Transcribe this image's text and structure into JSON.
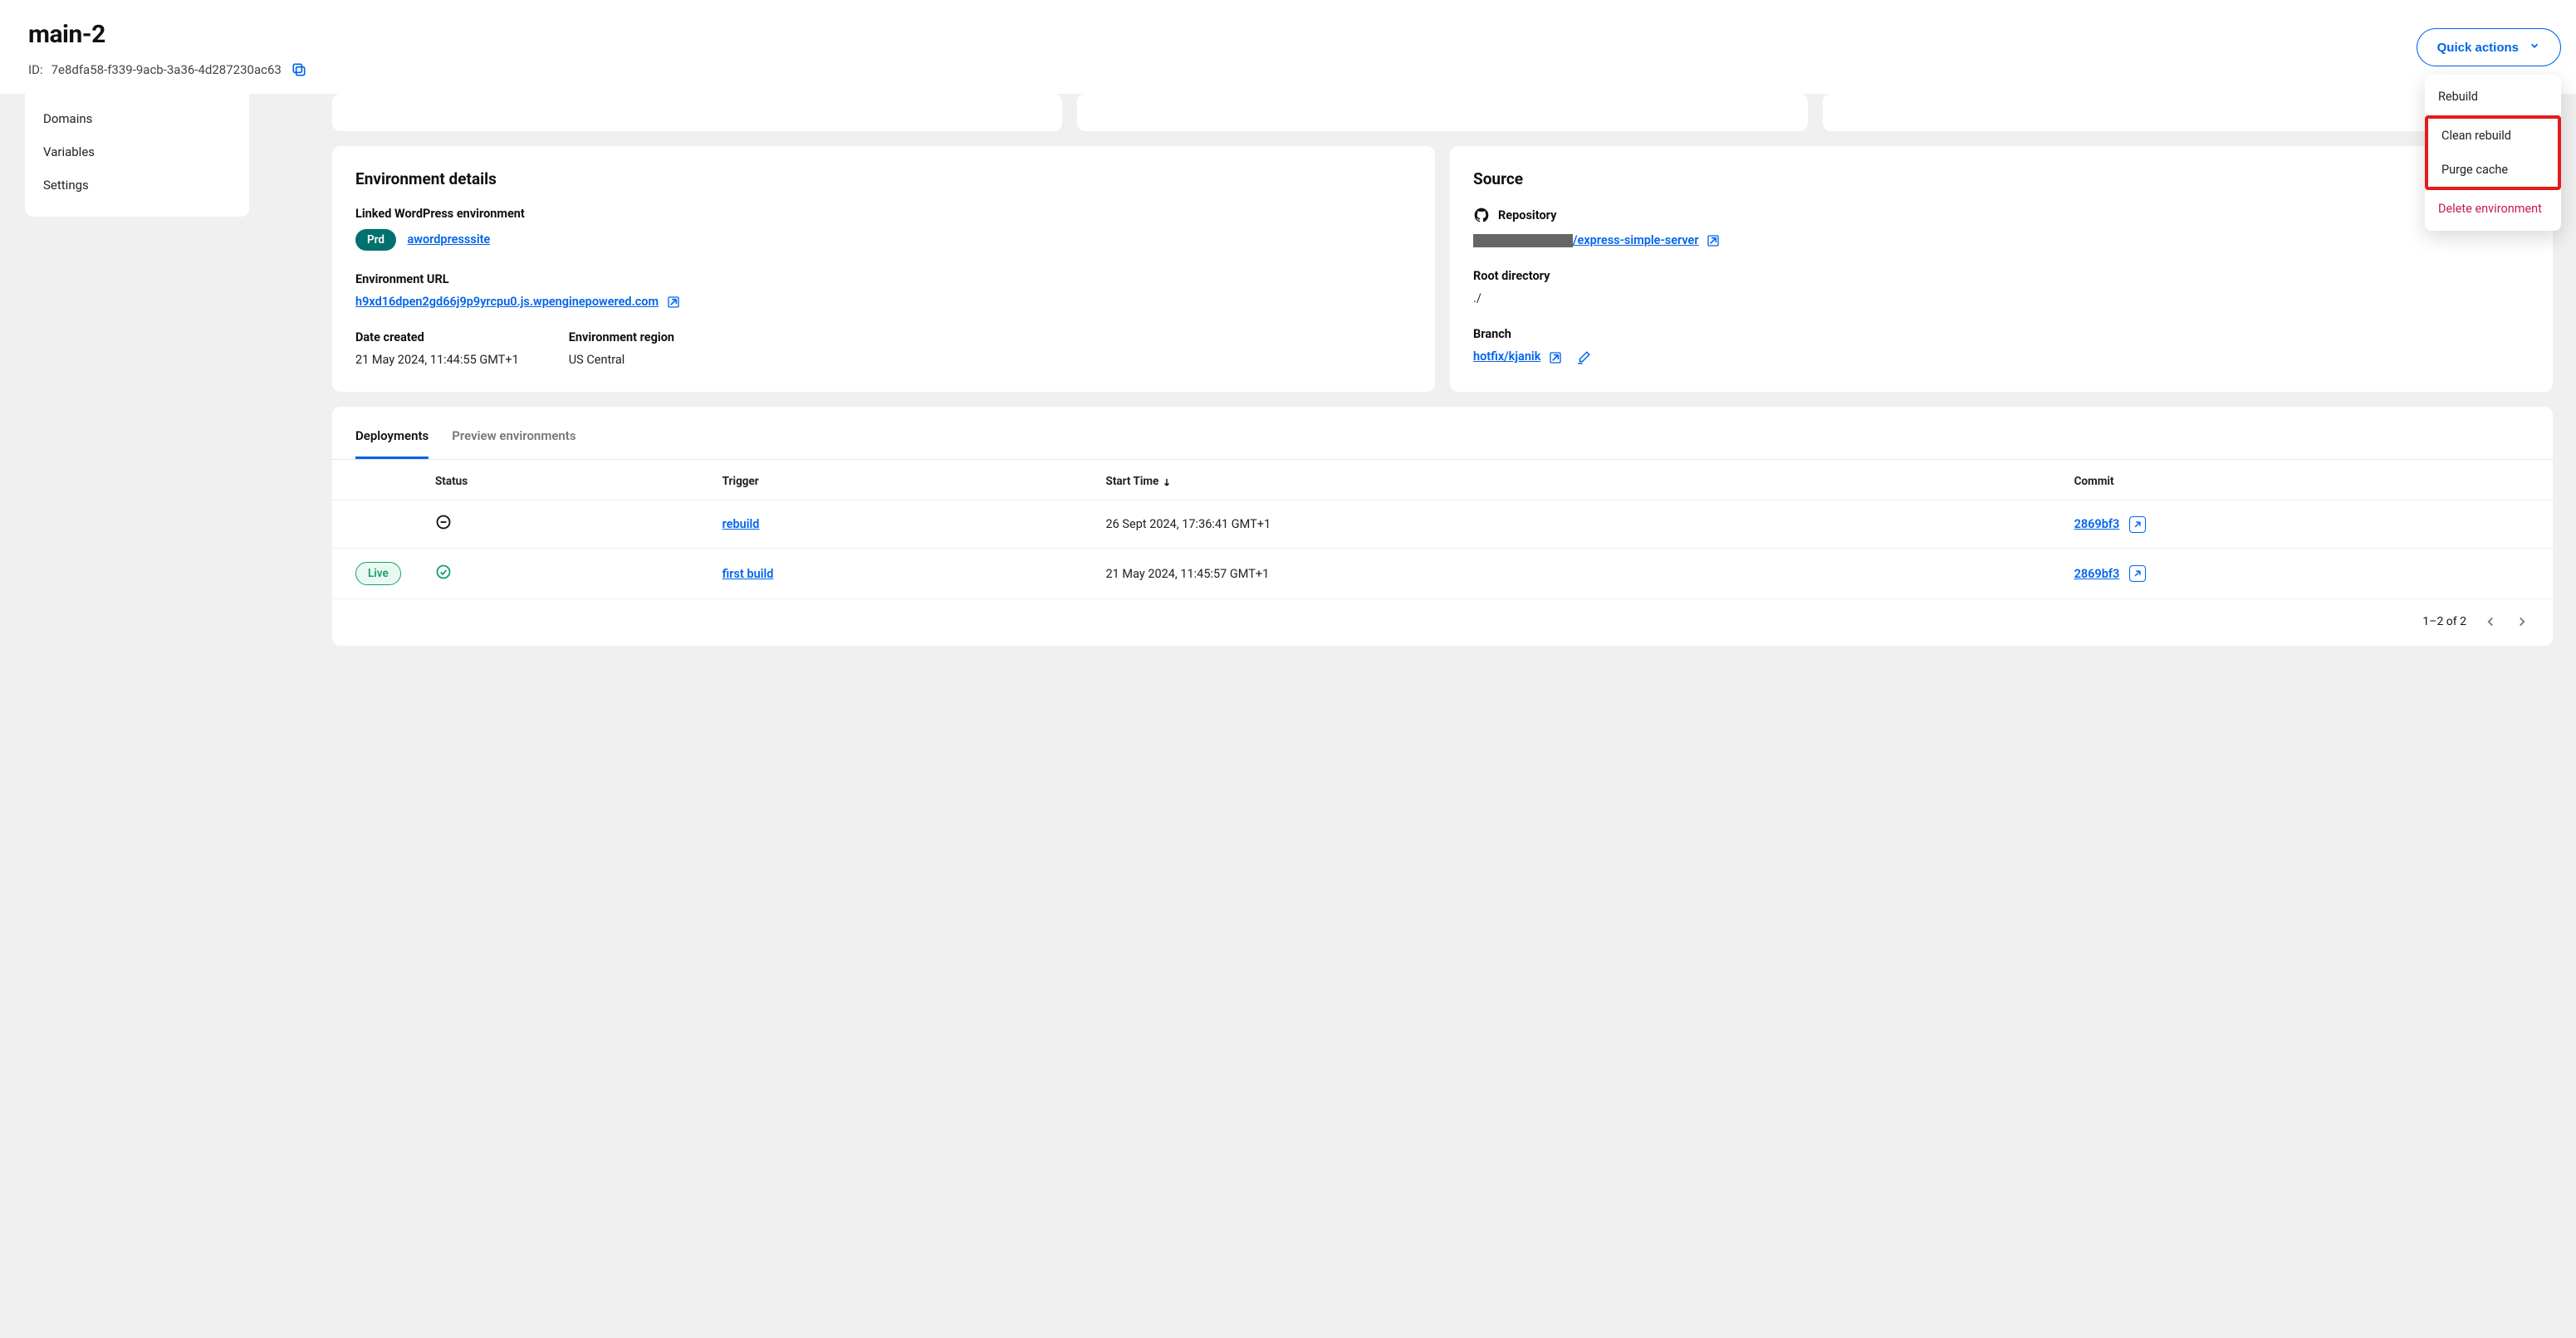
{
  "header": {
    "title": "main-2",
    "id_label": "ID:",
    "id_value": "7e8dfa58-f339-9acb-3a36-4d287230ac63",
    "quick_actions_label": "Quick actions"
  },
  "quick_menu": {
    "rebuild": "Rebuild",
    "clean_rebuild": "Clean rebuild",
    "purge_cache": "Purge cache",
    "delete_env": "Delete environment"
  },
  "sidebar": {
    "domains": "Domains",
    "variables": "Variables",
    "settings": "Settings"
  },
  "env_details": {
    "title": "Environment details",
    "linked_label": "Linked WordPress environment",
    "prd_badge": "Prd",
    "wp_link": "awordpresssite",
    "url_label": "Environment URL",
    "url_value": "h9xd16dpen2gd66j9p9yrcpu0.js.wpenginepowered.com",
    "date_label": "Date created",
    "date_value": "21 May 2024, 11:44:55 GMT+1",
    "region_label": "Environment region",
    "region_value": "US Central"
  },
  "source": {
    "title": "Source",
    "repo_label": "Repository",
    "repo_link": "/express-simple-server",
    "root_label": "Root directory",
    "root_value": "./",
    "branch_label": "Branch",
    "branch_value": "hotfix/kjanik"
  },
  "deployments": {
    "tabs": {
      "deployments": "Deployments",
      "preview": "Preview environments"
    },
    "columns": {
      "status": "Status",
      "trigger": "Trigger",
      "start_time": "Start Time",
      "commit": "Commit"
    },
    "rows": [
      {
        "live": "",
        "status": "cancelled",
        "trigger": "rebuild",
        "start_time": "26 Sept 2024, 17:36:41 GMT+1",
        "commit": "2869bf3"
      },
      {
        "live": "Live",
        "status": "success",
        "trigger": "first build",
        "start_time": "21 May 2024, 11:45:57 GMT+1",
        "commit": "2869bf3"
      }
    ],
    "pagination": "1–2 of 2"
  }
}
